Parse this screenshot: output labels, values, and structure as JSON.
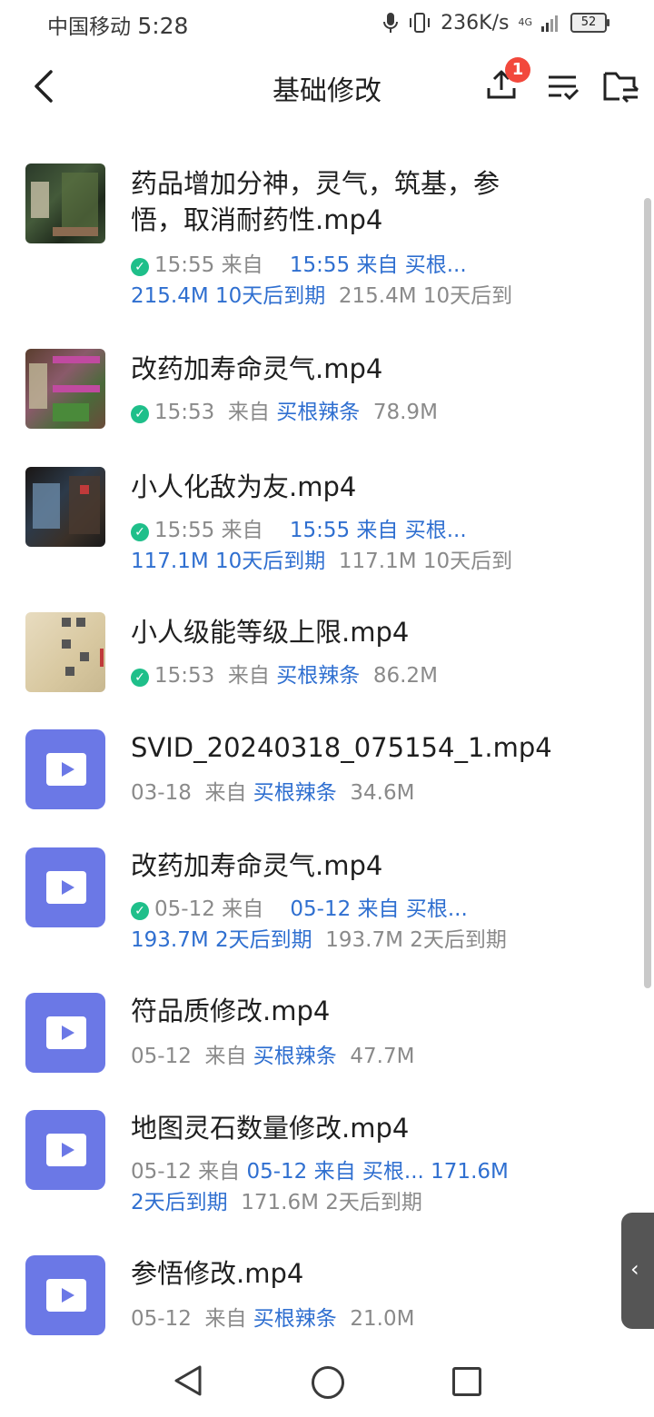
{
  "status_bar": {
    "carrier": "中国移动",
    "time": "5:28",
    "speed": "236K/s",
    "network": "4G",
    "battery": "52"
  },
  "header": {
    "title": "基础修改",
    "upload_badge": "1"
  },
  "files": [
    {
      "name": "药品增加分神，灵气，筑基，参悟，取消耐药性.mp4",
      "line1a": "15:55  来自",
      "line1b": "15:55  来自  买根...",
      "line2a": "215.4M  10天后到期",
      "line2b": "215.4M  10天后到"
    },
    {
      "name": "改药加寿命灵气.mp4",
      "time": "15:53",
      "from": "来自",
      "source": "买根辣条",
      "size": "78.9M"
    },
    {
      "name": "小人化敌为友.mp4",
      "line1a": "15:55  来自",
      "line1b": "15:55  来自  买根...",
      "line2a": "117.1M  10天后到期",
      "line2b": "117.1M  10天后到"
    },
    {
      "name": "小人级能等级上限.mp4",
      "time": "15:53",
      "from": "来自",
      "source": "买根辣条",
      "size": "86.2M"
    },
    {
      "name": "SVID_20240318_075154_1.mp4",
      "time": "03-18",
      "from": "来自",
      "source": "买根辣条",
      "size": "34.6M"
    },
    {
      "name": "改药加寿命灵气.mp4",
      "line1a": "05-12  来自",
      "line1b": "05-12  来自  买根...",
      "line2a": "193.7M  2天后到期",
      "line2b": "193.7M  2天后到期"
    },
    {
      "name": "符品质修改.mp4",
      "time": "05-12",
      "from": "来自",
      "source": "买根辣条",
      "size": "47.7M"
    },
    {
      "name": "地图灵石数量修改.mp4",
      "line1a": "05-12  来自",
      "line1b": "05-12  来自  买根...  171.6M",
      "line2a": "2天后到期",
      "line2b": "171.6M  2天后到期"
    },
    {
      "name": "参悟修改.mp4",
      "time": "05-12",
      "from": "来自",
      "source": "买根辣条",
      "size": "21.0M"
    }
  ]
}
